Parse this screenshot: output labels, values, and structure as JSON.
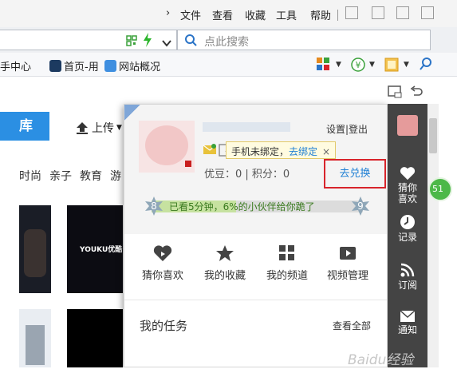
{
  "menubar": {
    "items": [
      "文件",
      "查看",
      "收藏",
      "工具",
      "帮助"
    ]
  },
  "address": {
    "search_placeholder": "点此搜索"
  },
  "bookmarks": {
    "partial": "手中心",
    "home": "首页-用",
    "site": "网站概况"
  },
  "page": {
    "library_button": "库",
    "upload": "上传",
    "categories": [
      "时尚",
      "亲子",
      "教育",
      "游"
    ],
    "thumb_brand": "YOUKU优酷"
  },
  "popup": {
    "links": "设置|登出",
    "phone_tip": "手机未绑定，",
    "bind_link": "去绑定",
    "close_glyph": "×",
    "points": "优豆：0 | 积分：0",
    "exchange": "去兑换",
    "level_current": "8",
    "level_next": "9",
    "level_progress_text": "已看5分钟，6%的小伙伴给你跪了",
    "level_progress_fraction": 0.4,
    "quick_links": [
      {
        "icon": "heart-icon",
        "label": "猜你喜欢"
      },
      {
        "icon": "star-icon",
        "label": "我的收藏"
      },
      {
        "icon": "grid-icon",
        "label": "我的频道"
      },
      {
        "icon": "video-icon",
        "label": "视频管理"
      }
    ],
    "tasks_title": "我的任务",
    "view_all": "查看全部"
  },
  "sidebar": {
    "items": [
      {
        "icon": "heart-icon",
        "label": "猜你喜欢"
      },
      {
        "icon": "clock-icon",
        "label": "记录"
      },
      {
        "icon": "rss-icon",
        "label": "订阅"
      },
      {
        "icon": "mail-icon",
        "label": "通知"
      }
    ],
    "badge": "51"
  },
  "watermark": "Baidu经验",
  "colors": {
    "accent_blue": "#2b8fe3",
    "highlight_red": "#d8242b",
    "sidebar_dark": "#444444",
    "level_green": "#c6e2a0"
  }
}
